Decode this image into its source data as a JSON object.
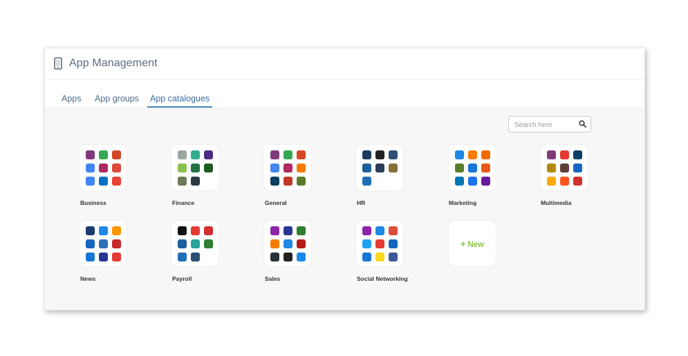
{
  "header": {
    "title": "App Management",
    "icon": "mobile-phone-icon"
  },
  "tabs": [
    {
      "label": "Apps",
      "active": false
    },
    {
      "label": "App groups",
      "active": false
    },
    {
      "label": "App catalogues",
      "active": true
    }
  ],
  "search": {
    "placeholder": "Search here",
    "value": ""
  },
  "colors": {
    "accent": "#4a86bd",
    "new_green": "#8bc34a",
    "panel_background": "#f7f7f7"
  },
  "catalogues": [
    {
      "name": "Business",
      "icons": [
        "#80397b",
        "#34a853",
        "#d24726",
        "#4285f4",
        "#b0295f",
        "#dd4b39",
        "#4285f4",
        "#0072c6",
        "#e94235"
      ]
    },
    {
      "name": "Finance",
      "icons": [
        "#9aa5a0",
        "#2fae8f",
        "#4b2e83",
        "#8bc34a",
        "#217346",
        "#1b5e20",
        "#6d7b55",
        "#2b3a42"
      ]
    },
    {
      "name": "General",
      "icons": [
        "#80397b",
        "#34a853",
        "#d24726",
        "#4285f4",
        "#b0295f",
        "#f57c00",
        "#0a3d62",
        "#c0392b",
        "#5d7c2a"
      ]
    },
    {
      "name": "HR",
      "icons": [
        "#1d3b5c",
        "#222222",
        "#2d4f73",
        "#1e5f99",
        "#2b3d55",
        "#8a6d3b",
        "#1f6fb5"
      ]
    },
    {
      "name": "Marketing",
      "icons": [
        "#1e88e5",
        "#f57c00",
        "#ef6c00",
        "#5a7d2a",
        "#1976d2",
        "#e8591a",
        "#0077b5",
        "#1a73e8",
        "#6a1b9a"
      ]
    },
    {
      "name": "Multimedia",
      "icons": [
        "#80397b",
        "#e53935",
        "#0a3d62",
        "#b8860b",
        "#5d4037",
        "#1565c0",
        "#f9ab00",
        "#ff5722",
        "#d32f2f"
      ]
    },
    {
      "name": "News",
      "icons": [
        "#1a3c6e",
        "#1e88e5",
        "#ff9800",
        "#1565c0",
        "#2e6fb7",
        "#c62828",
        "#1976d2",
        "#283593",
        "#e53935"
      ]
    },
    {
      "name": "Payroll",
      "icons": [
        "#111111",
        "#e53935",
        "#d32f2f",
        "#1e5f99",
        "#26a69a",
        "#2e7d32",
        "#1f6fb5",
        "#2d4f73"
      ]
    },
    {
      "name": "Sales",
      "icons": [
        "#8e24aa",
        "#283593",
        "#2e7d32",
        "#f57c00",
        "#1e88e5",
        "#b71c1c",
        "#263238",
        "#212121",
        "#1e88e5"
      ]
    },
    {
      "name": "Social Networking",
      "icons": [
        "#8e24aa",
        "#1e88e5",
        "#dd4b39",
        "#1da1f2",
        "#e53935",
        "#1565c0",
        "#1976d2",
        "#f9d71c",
        "#3b5998"
      ]
    }
  ],
  "new_card": {
    "label": "New",
    "plus": "+"
  }
}
